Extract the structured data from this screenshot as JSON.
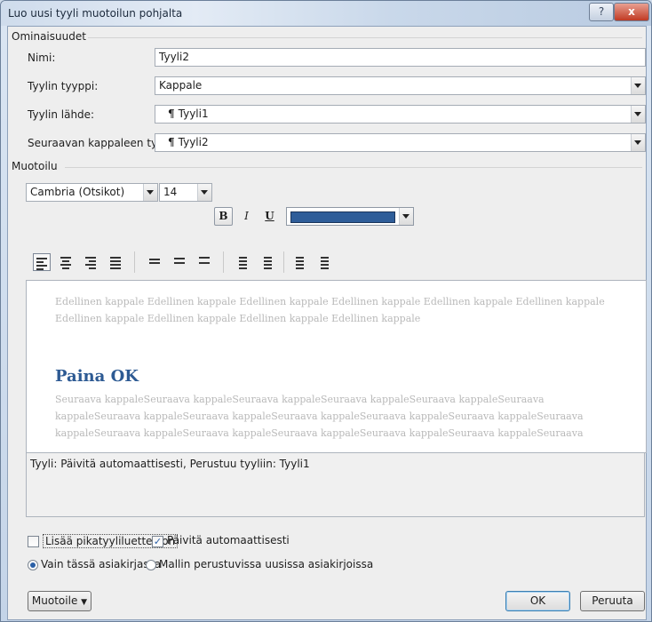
{
  "dialog": {
    "title": "Luo uusi tyyli muotoilun pohjalta",
    "help": "?",
    "close": "x"
  },
  "properties": {
    "group_label": "Ominaisuudet",
    "name_label": "Nimi:",
    "name_value": "Tyyli2",
    "type_label": "Tyylin tyyppi:",
    "type_value": "Kappale",
    "base_label": "Tyylin lähde:",
    "base_value": "Tyyli1",
    "next_label": "Seuraavan kappaleen tyyli:",
    "next_value": "Tyyli2",
    "pilcrow": "¶"
  },
  "formatting": {
    "group_label": "Muotoilu",
    "font": "Cambria (Otsikot)",
    "size": "14",
    "bold": "B",
    "italic": "I",
    "underline": "U",
    "color": "#2e5d99"
  },
  "preview": {
    "previous": "Edellinen kappale Edellinen kappale Edellinen kappale Edellinen kappale Edellinen kappale Edellinen kappale Edellinen kappale Edellinen kappale Edellinen kappale Edellinen kappale",
    "heading": "Paina OK",
    "following": "Seuraava kappaleSeuraava kappaleSeuraava kappaleSeuraava kappaleSeuraava kappaleSeuraava kappaleSeuraava kappaleSeuraava kappaleSeuraava kappaleSeuraava kappaleSeuraava kappaleSeuraava kappaleSeuraava kappaleSeuraava kappaleSeuraava kappaleSeuraava kappaleSeuraava kappaleSeuraava"
  },
  "description": "Tyyli: Päivitä automaattisesti, Perustuu tyyliin: Tyyli1",
  "options": {
    "add_quick": "Lisää pikatyyliluetteloon",
    "auto_update": "Päivitä automaattisesti",
    "this_doc": "Vain tässä asiakirjassa",
    "template_docs": "Mallin perustuvissa uusissa asiakirjoissa"
  },
  "buttons": {
    "format": "Muotoile",
    "ok": "OK",
    "cancel": "Peruuta"
  }
}
